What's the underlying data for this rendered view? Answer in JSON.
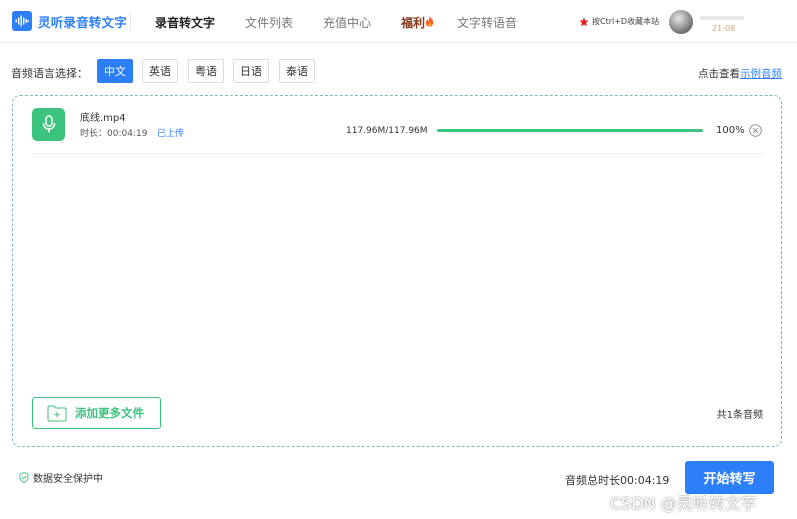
{
  "header": {
    "logo_text": "灵听录音转文字",
    "nav": [
      {
        "label": "录音转文字"
      },
      {
        "label": "文件列表"
      },
      {
        "label": "充值中心"
      },
      {
        "label": "福利"
      },
      {
        "label": "文字转语音"
      }
    ],
    "bookmark_tip": "按Ctrl+D收藏本站",
    "user_date": "21-08"
  },
  "language": {
    "label": "音频语言选择：",
    "options": [
      {
        "label": "中文",
        "selected": true
      },
      {
        "label": "英语",
        "selected": false
      },
      {
        "label": "粤语",
        "selected": false
      },
      {
        "label": "日语",
        "selected": false
      },
      {
        "label": "泰语",
        "selected": false
      }
    ],
    "sample_prefix": "点击查看",
    "sample_link": "示例音频"
  },
  "file": {
    "name": "底线.mp4",
    "duration_label": "时长：00:04:19",
    "status": "已上传",
    "size": "117.96M/117.96M",
    "progress_percent": 100,
    "progress_text": "100%"
  },
  "panel": {
    "add_more_label": "添加更多文件",
    "count_text": "共1条音频"
  },
  "footer": {
    "security_text": "数据安全保护中",
    "total_duration": "音频总时长00:04:19",
    "start_button": "开始转写",
    "watermark": "CSDN @灵听转文字"
  },
  "colors": {
    "accent": "#2d7ff9",
    "success": "#3cc37d",
    "welfare": "#8a3b1e"
  }
}
